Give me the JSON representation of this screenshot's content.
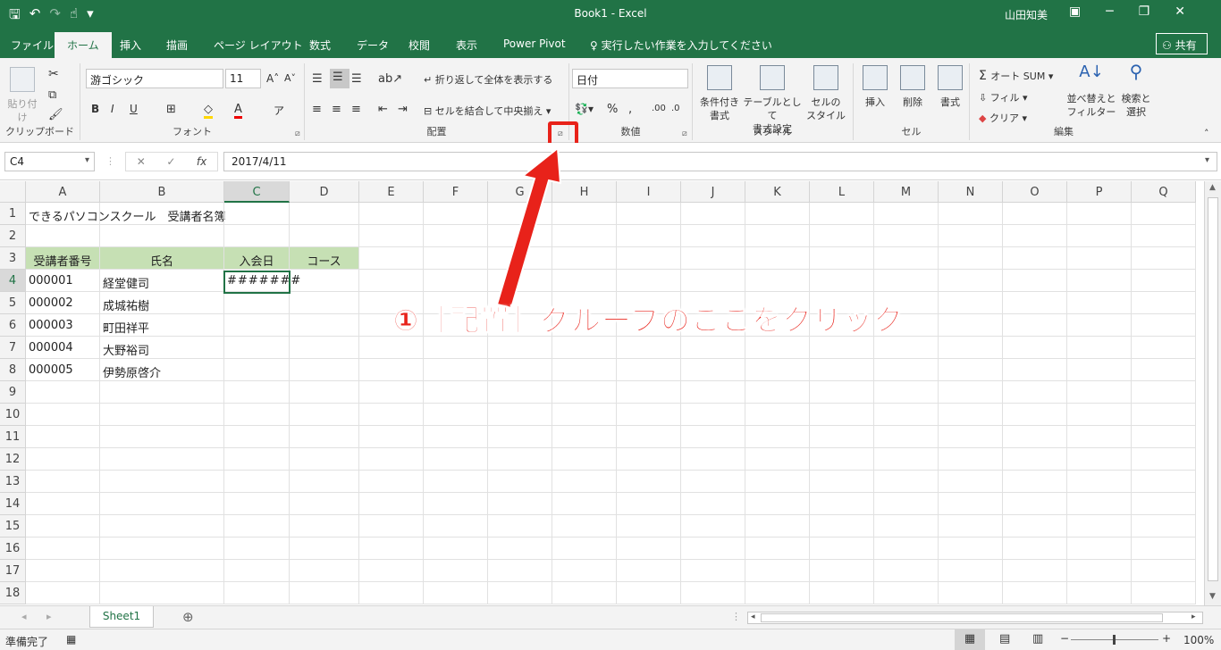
{
  "window": {
    "title": "Book1 - Excel",
    "user": "山田知美"
  },
  "tabs": [
    "ファイル",
    "ホーム",
    "挿入",
    "描画",
    "ページ レイアウト",
    "数式",
    "データ",
    "校閲",
    "表示",
    "Power Pivot"
  ],
  "tell_me": "実行したい作業を入力してください",
  "share": "共有",
  "ribbon": {
    "clipboard": {
      "paste": "貼り付け",
      "label": "クリップボード"
    },
    "font": {
      "name": "游ゴシック",
      "size": "11",
      "label": "フォント"
    },
    "alignment": {
      "wrap": "折り返して全体を表示する",
      "merge": "セルを結合して中央揃え",
      "label": "配置"
    },
    "number": {
      "format": "日付",
      "label": "数値"
    },
    "styles": {
      "cond": "条件付き\n書式",
      "table": "テーブルとして\n書式設定",
      "cell": "セルの\nスタイル",
      "label": "スタイル"
    },
    "cells": {
      "insert": "挿入",
      "delete": "削除",
      "format": "書式",
      "label": "セル"
    },
    "editing": {
      "autosum": "オート SUM",
      "fill": "フィル",
      "clear": "クリア",
      "sort": "並べ替えと\nフィルター",
      "find": "検索と\n選択",
      "label": "編集"
    }
  },
  "formula": {
    "namebox": "C4",
    "value": "2017/4/11"
  },
  "columns": [
    "A",
    "B",
    "C",
    "D",
    "E",
    "F",
    "G",
    "H",
    "I",
    "J",
    "K",
    "L",
    "M",
    "N",
    "O",
    "P",
    "Q"
  ],
  "rows": [
    "1",
    "2",
    "3",
    "4",
    "5",
    "6",
    "7",
    "8",
    "9",
    "10",
    "11",
    "12",
    "13",
    "14",
    "15",
    "16",
    "17",
    "18"
  ],
  "cells": {
    "A1": "できるパソコンスクール　受講者名簿",
    "A3": "受講者番号",
    "B3": "氏名",
    "C3": "入会日",
    "D3": "コース",
    "A4": "000001",
    "B4": "経堂健司",
    "C4": "#######",
    "A5": "000002",
    "B5": "成城祐樹",
    "A6": "000003",
    "B6": "町田祥平",
    "A7": "000004",
    "B7": "大野裕司",
    "A8": "000005",
    "B8": "伊勢原啓介"
  },
  "sheet": {
    "tab": "Sheet1"
  },
  "status": {
    "ready": "準備完了",
    "zoom": "100%"
  },
  "annotation": "①［配置］グループのここをクリック",
  "colors": {
    "excel_green": "#217346",
    "header_fill": "#c6e0b4",
    "annotation_red": "#e8221a"
  }
}
